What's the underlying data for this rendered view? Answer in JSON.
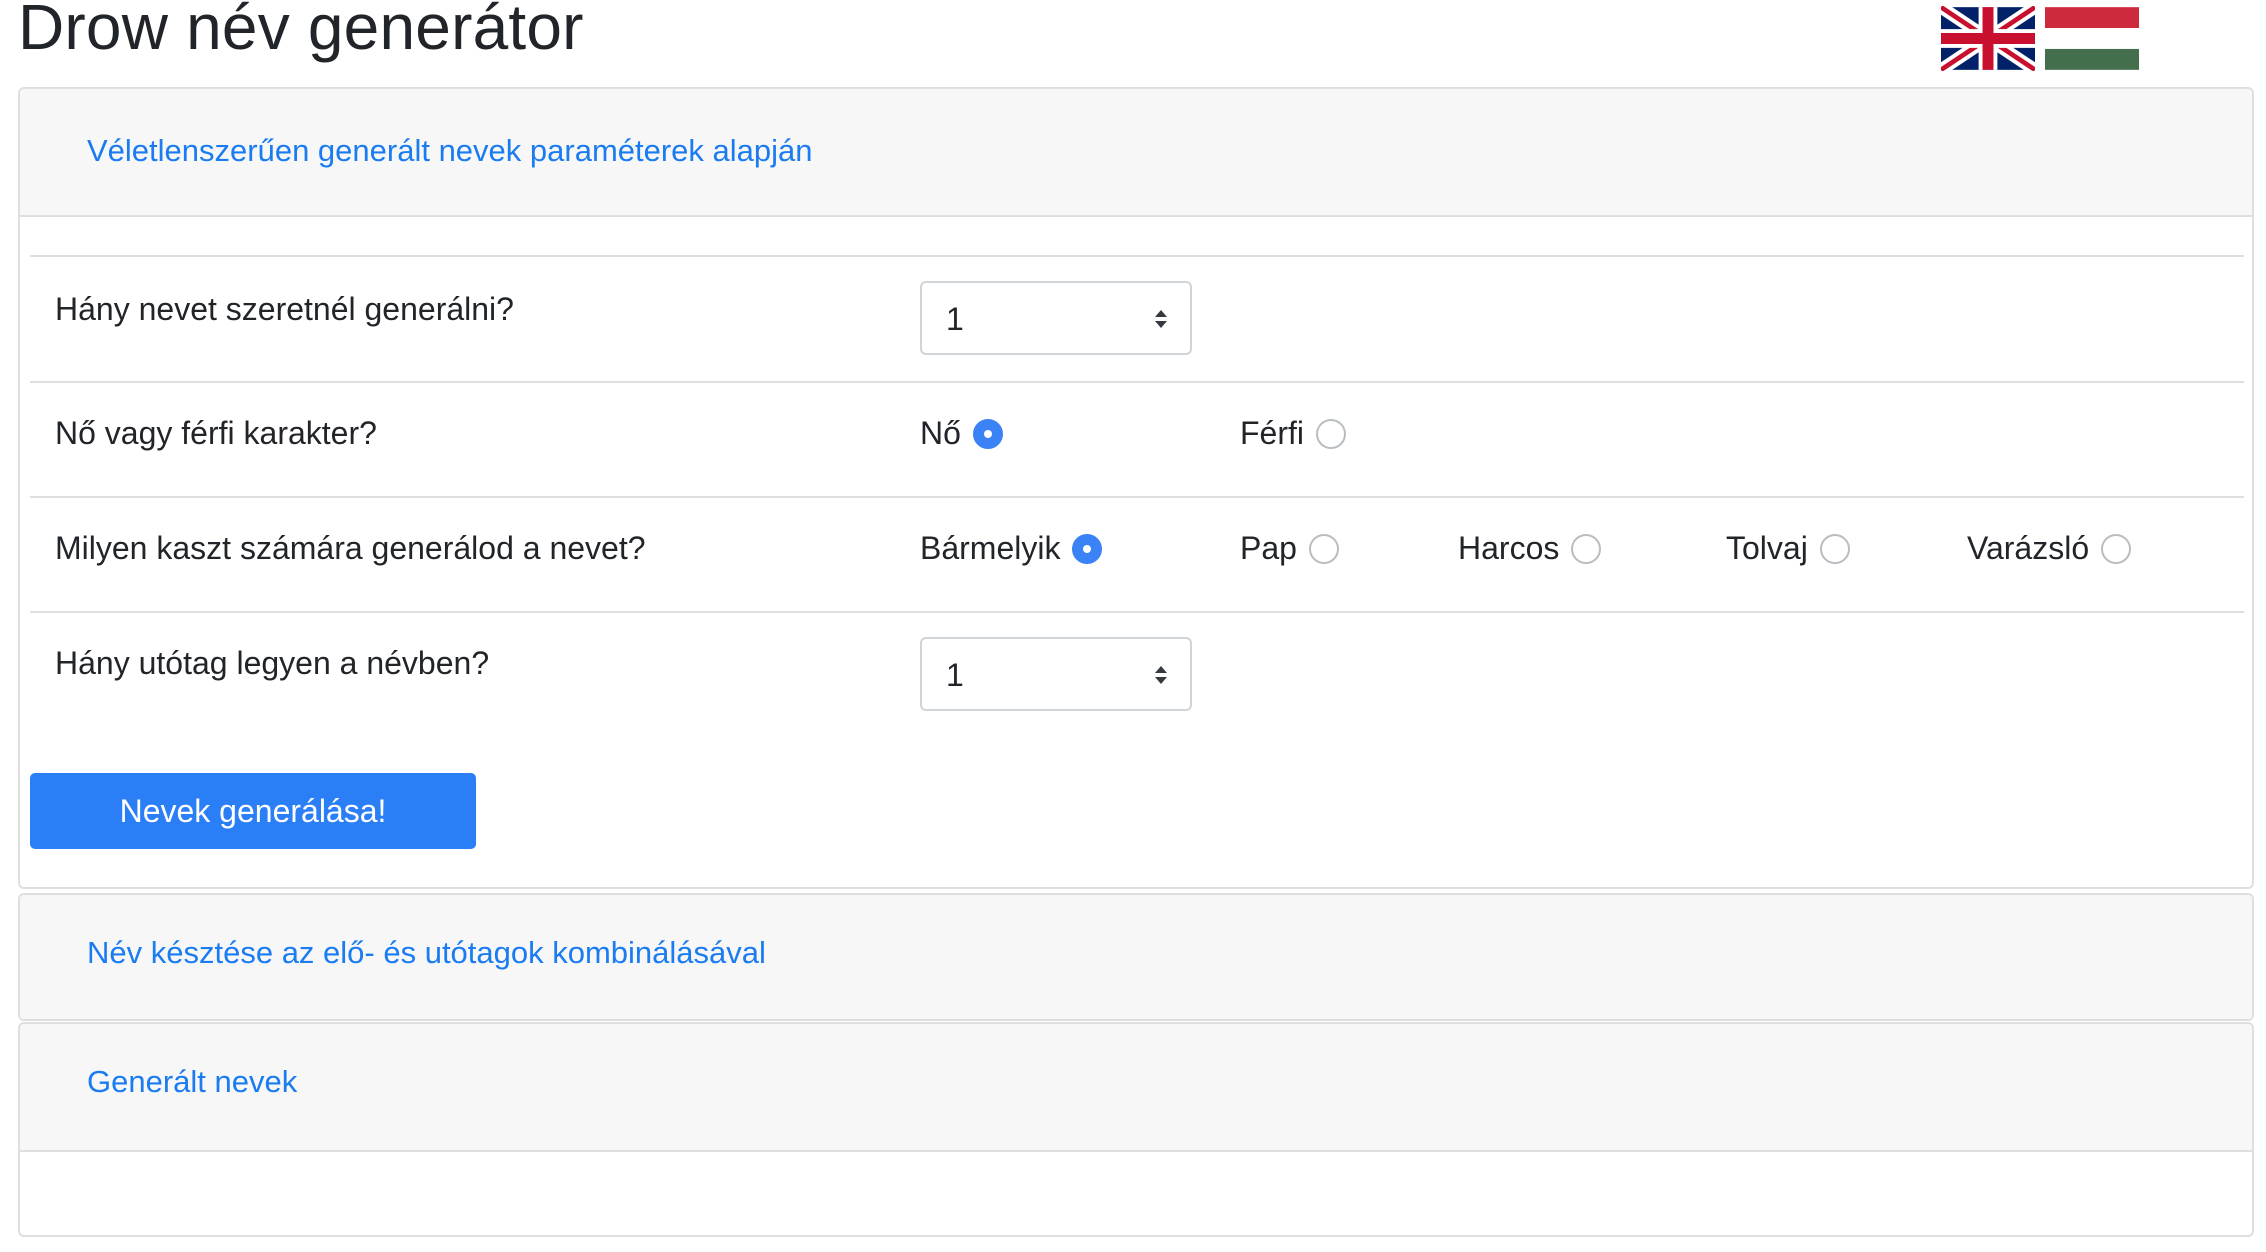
{
  "page": {
    "title": "Drow név generátor",
    "flags": [
      "uk-flag-icon",
      "hungary-flag-icon"
    ]
  },
  "sections": {
    "random": {
      "header": "Véletlenszerűen generált nevek paraméterek alapján",
      "count_question": "Hány nevet szeretnél generálni?",
      "count_value": "1",
      "gender_question": "Nő vagy férfi karakter?",
      "gender_options": [
        {
          "label": "Nő",
          "selected": true
        },
        {
          "label": "Férfi",
          "selected": false
        }
      ],
      "class_question": "Milyen kaszt számára generálod a nevet?",
      "class_options": [
        {
          "label": "Bármelyik",
          "selected": true
        },
        {
          "label": "Pap",
          "selected": false
        },
        {
          "label": "Harcos",
          "selected": false
        },
        {
          "label": "Tolvaj",
          "selected": false
        },
        {
          "label": "Varázsló",
          "selected": false
        }
      ],
      "suffix_question": "Hány utótag legyen a névben?",
      "suffix_value": "1",
      "generate_button": "Nevek generálása!"
    },
    "combine": {
      "header": "Név késztése az elő- és utótagok kombinálásával"
    },
    "generated": {
      "header": "Generált nevek"
    }
  },
  "colors": {
    "accent": "#2b7ff6",
    "link": "#1a7cf0",
    "header_bg": "#f7f7f7",
    "border": "#dfdfdf"
  }
}
